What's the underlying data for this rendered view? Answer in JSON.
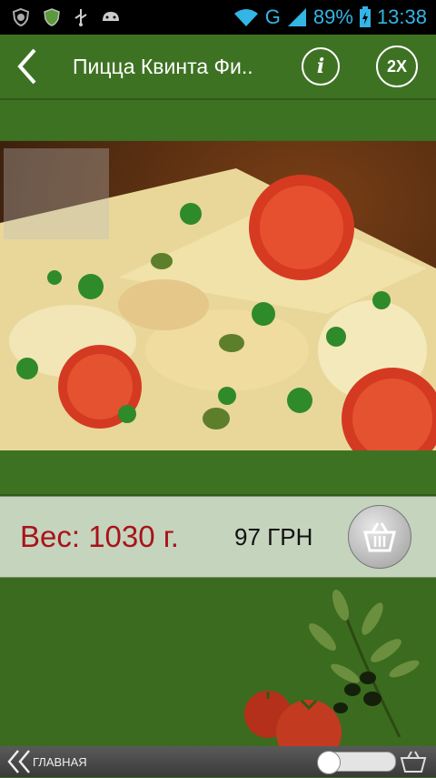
{
  "status_bar": {
    "network": "G",
    "battery": "89%",
    "time": "13:38",
    "color": "#33b5e5"
  },
  "header": {
    "title": "Пицца Квинта Фи..",
    "info_label": "i",
    "zoom_label": "2X"
  },
  "product": {
    "weight": "Вес: 1030 г.",
    "price": "97 ГРН",
    "weight_color": "#a8131b"
  },
  "footer": {
    "home_label": "ГЛАВНАЯ"
  },
  "icons": {
    "back": "chevron-left-icon",
    "info": "info-icon",
    "zoom": "zoom-2x-icon",
    "cart": "basket-icon",
    "home": "double-chevron-left-icon"
  }
}
